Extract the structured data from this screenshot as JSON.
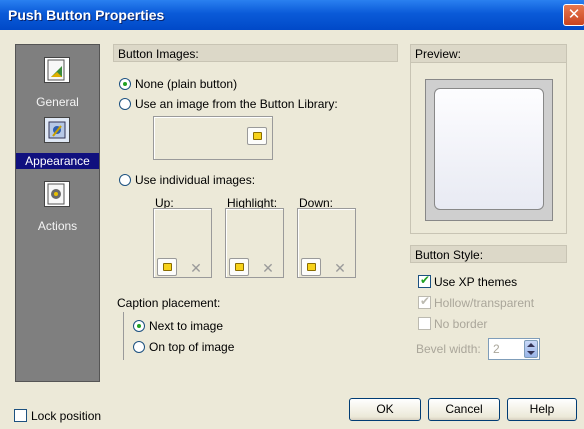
{
  "window": {
    "title": "Push Button Properties",
    "close_label": "✕"
  },
  "nav": {
    "items": [
      {
        "label": "General",
        "selected": false
      },
      {
        "label": "Appearance",
        "selected": true
      },
      {
        "label": "Actions",
        "selected": false
      }
    ]
  },
  "button_images": {
    "header": "Button Images:",
    "options": {
      "none": "None (plain button)",
      "library": "Use an image from the Button Library:",
      "individual": "Use individual images:"
    },
    "selected": "none",
    "up_label": "Up:",
    "highlight_label": "Highlight:",
    "down_label": "Down:"
  },
  "caption": {
    "label": "Caption placement:",
    "next_to": "Next to image",
    "on_top": "On top of image",
    "selected": "next_to"
  },
  "preview": {
    "header": "Preview:"
  },
  "button_style": {
    "header": "Button Style:",
    "use_xp_themes": {
      "label": "Use XP themes",
      "checked": true
    },
    "hollow": {
      "label": "Hollow/transparent",
      "checked": true,
      "disabled": true
    },
    "no_border": {
      "label": "No border",
      "checked": false,
      "disabled": true
    },
    "bevel_label": "Bevel width:",
    "bevel_value": "2"
  },
  "footer": {
    "lock_position": "Lock position",
    "ok": "OK",
    "cancel": "Cancel",
    "help": "Help"
  },
  "icons": {
    "general": "general-properties-icon",
    "appearance": "appearance-icon",
    "actions": "actions-icon",
    "browse": "folder-browse-icon",
    "clear": "clear-x-icon"
  }
}
